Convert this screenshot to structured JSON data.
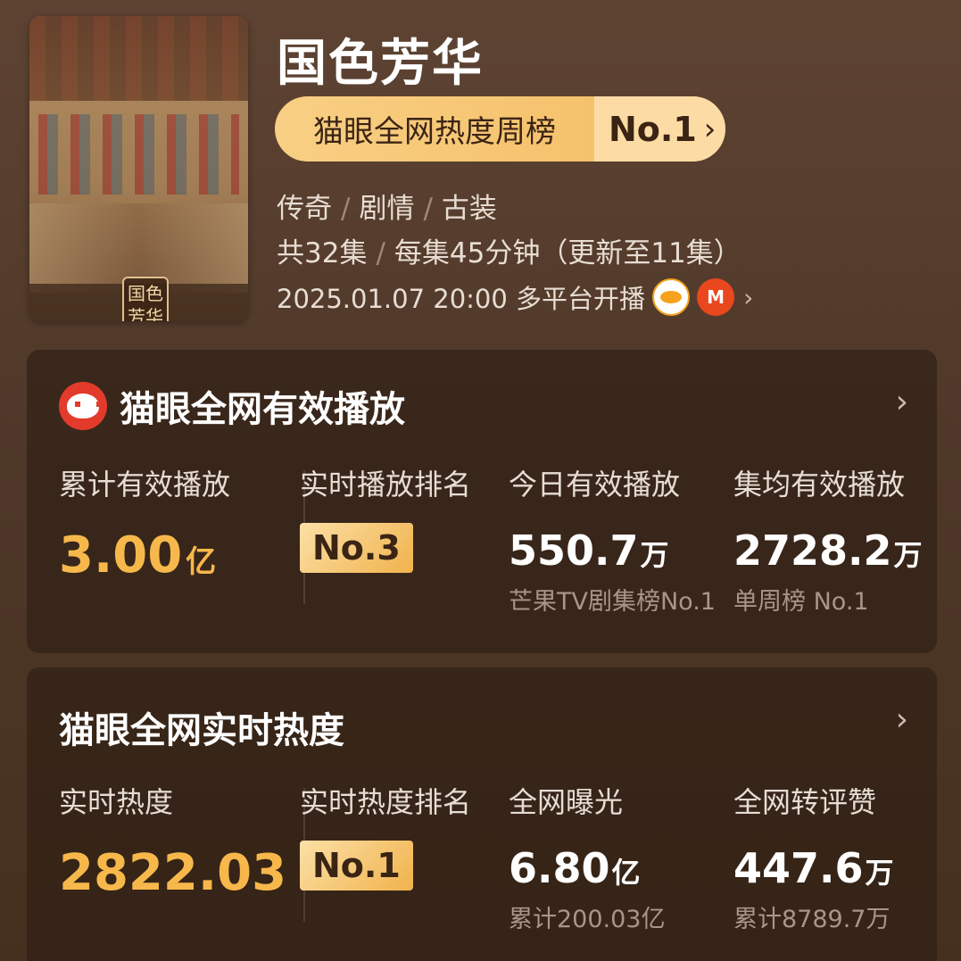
{
  "header": {
    "title": "国色芳华",
    "rank_pill": {
      "label": "猫眼全网热度周榜",
      "rank": "No.1",
      "chevron": "›"
    },
    "genres": [
      "传奇",
      "剧情",
      "古装"
    ],
    "episodes": "共32集",
    "duration": "每集45分钟（更新至11集）",
    "release": "2025.01.07 20:00 多平台开播",
    "platform_icons": [
      "hunan-tv-icon",
      "mgtv-icon"
    ]
  },
  "poster": {
    "seal_text_1": "国色",
    "seal_text_2": "芳华"
  },
  "play_card": {
    "title": "猫眼全网有效播放",
    "total": {
      "label": "累计有效播放",
      "value": "3.00",
      "unit": "亿"
    },
    "rank": {
      "label": "实时播放排名",
      "value": "No.3"
    },
    "today": {
      "label": "今日有效播放",
      "value": "550.7",
      "unit": "万",
      "sub": "芒果TV剧集榜No.1"
    },
    "avg": {
      "label": "集均有效播放",
      "value": "2728.2",
      "unit": "万",
      "sub": "单周榜 No.1"
    }
  },
  "heat_card": {
    "title": "猫眼全网实时热度",
    "heat": {
      "label": "实时热度",
      "value": "2822.03"
    },
    "rank": {
      "label": "实时热度排名",
      "value": "No.1"
    },
    "exposure": {
      "label": "全网曝光",
      "value": "6.80",
      "unit": "亿",
      "sub": "累计200.03亿"
    },
    "engagement": {
      "label": "全网转评赞",
      "value": "447.6",
      "unit": "万",
      "sub": "累计8789.7万"
    }
  },
  "colors": {
    "accent": "#f7b84b",
    "background": "#5e4333"
  }
}
